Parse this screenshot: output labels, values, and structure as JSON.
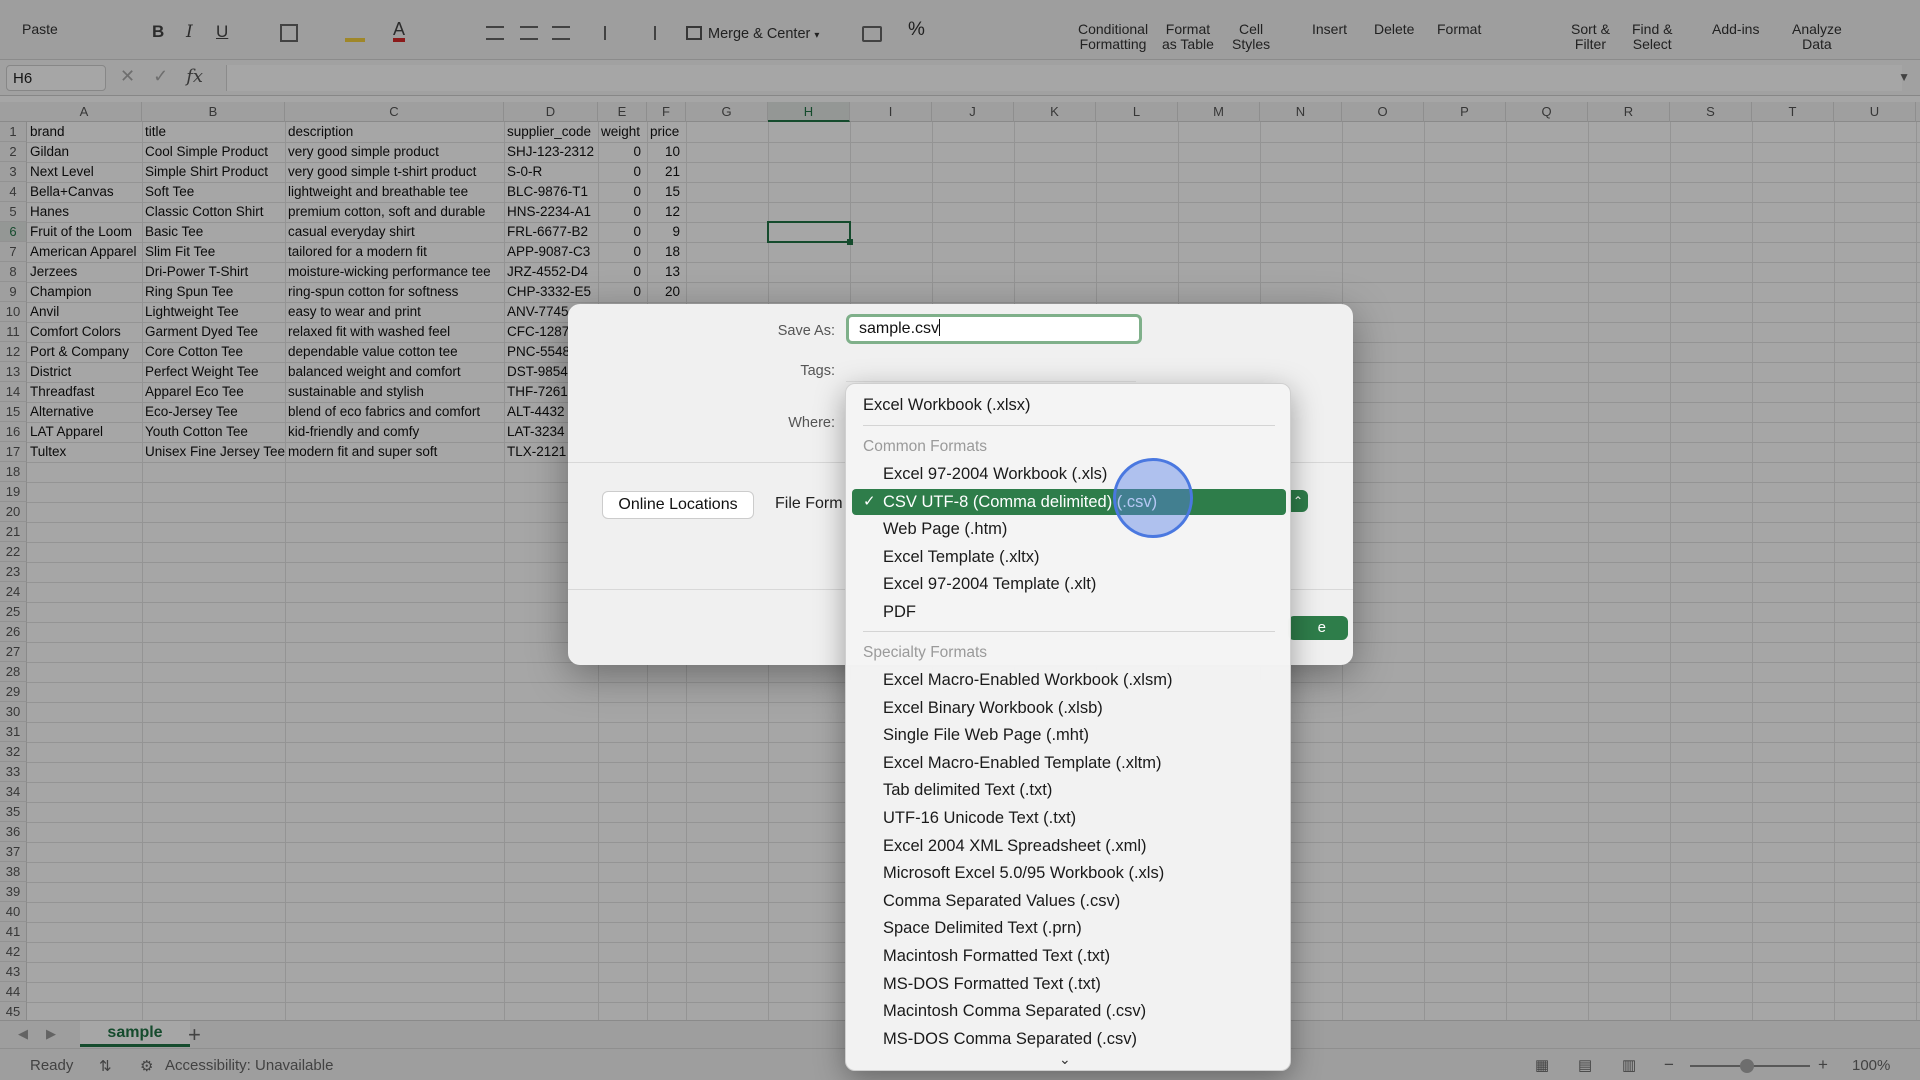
{
  "ribbon": {
    "paste": "Paste",
    "merge_center": "Merge & Center",
    "conditional_formatting": [
      "Conditional",
      "Formatting"
    ],
    "format_as_table": [
      "Format",
      "as Table"
    ],
    "cell_styles": [
      "Cell",
      "Styles"
    ],
    "insert": "Insert",
    "delete": "Delete",
    "format": "Format",
    "sort_filter": [
      "Sort &",
      "Filter"
    ],
    "find_select": [
      "Find &",
      "Select"
    ],
    "add_ins": "Add-ins",
    "analyze_data": [
      "Analyze",
      "Data"
    ],
    "font_buttons": [
      "B",
      "I",
      "U"
    ],
    "percent": "%"
  },
  "formula_bar": {
    "name_box": "H6",
    "fx": "fx"
  },
  "sheet": {
    "columns": [
      "A",
      "B",
      "C",
      "D",
      "E",
      "F",
      "G",
      "H",
      "I",
      "J",
      "K",
      "L",
      "M",
      "N",
      "O",
      "P",
      "Q",
      "R",
      "S",
      "T",
      "U"
    ],
    "selected_column": "H",
    "selected_row": 6,
    "row_count": 45,
    "header": [
      "brand",
      "title",
      "description",
      "supplier_code",
      "weight",
      "price"
    ],
    "rows": [
      [
        "Gildan",
        "Cool Simple Product",
        "very good simple product",
        "SHJ-123-2312",
        "0",
        "10"
      ],
      [
        "Next Level",
        "Simple Shirt Product",
        "very good simple t-shirt product",
        "S-0-R",
        "0",
        "21"
      ],
      [
        "Bella+Canvas",
        "Soft Tee",
        "lightweight and breathable tee",
        "BLC-9876-T1",
        "0",
        "15"
      ],
      [
        "Hanes",
        "Classic Cotton Shirt",
        "premium cotton, soft and durable",
        "HNS-2234-A1",
        "0",
        "12"
      ],
      [
        "Fruit of the Loom",
        "Basic Tee",
        "casual everyday shirt",
        "FRL-6677-B2",
        "0",
        "9"
      ],
      [
        "American Apparel",
        "Slim Fit Tee",
        "tailored for a modern fit",
        "APP-9087-C3",
        "0",
        "18"
      ],
      [
        "Jerzees",
        "Dri-Power T-Shirt",
        "moisture-wicking performance tee",
        "JRZ-4552-D4",
        "0",
        "13"
      ],
      [
        "Champion",
        "Ring Spun Tee",
        "ring-spun cotton for softness",
        "CHP-3332-E5",
        "0",
        "20"
      ],
      [
        "Anvil",
        "Lightweight Tee",
        "easy to wear and print",
        "ANV-7745",
        "",
        ""
      ],
      [
        "Comfort Colors",
        "Garment Dyed Tee",
        "relaxed fit with washed feel",
        "CFC-1287",
        "",
        ""
      ],
      [
        "Port & Company",
        "Core Cotton Tee",
        "dependable value cotton tee",
        "PNC-5548",
        "",
        ""
      ],
      [
        "District",
        "Perfect Weight Tee",
        "balanced weight and comfort",
        "DST-9854",
        "",
        ""
      ],
      [
        "Threadfast",
        "Apparel Eco Tee",
        "sustainable and stylish",
        "THF-7261",
        "",
        ""
      ],
      [
        "Alternative",
        "Eco-Jersey Tee",
        "blend of eco fabrics and comfort",
        "ALT-4432",
        "",
        ""
      ],
      [
        "LAT Apparel",
        "Youth Cotton Tee",
        "kid-friendly and comfy",
        "LAT-3234",
        "",
        ""
      ],
      [
        "Tultex",
        "Unisex Fine Jersey Tee",
        "modern fit and super soft",
        "TLX-2121",
        "",
        ""
      ]
    ],
    "tab_name": "sample"
  },
  "status": {
    "ready": "Ready",
    "accessibility": "Accessibility: Unavailable",
    "zoom": "100%"
  },
  "dialog": {
    "save_as_label": "Save As:",
    "save_as_value": "sample.csv",
    "tags_label": "Tags:",
    "where_label": "Where:",
    "online_locations": "Online Locations",
    "file_format_label": "File Form",
    "save_button": "e"
  },
  "format_menu": {
    "top_item": "Excel Workbook (.xlsx)",
    "common_header": "Common Formats",
    "common": [
      "Excel 97-2004 Workbook (.xls)",
      "CSV UTF-8 (Comma delimited) (.csv)",
      "Web Page (.htm)",
      "Excel Template (.xltx)",
      "Excel 97-2004 Template (.xlt)",
      "PDF"
    ],
    "selected_index": 1,
    "check": "✓",
    "specialty_header": "Specialty Formats",
    "specialty": [
      "Excel Macro-Enabled Workbook (.xlsm)",
      "Excel Binary Workbook (.xlsb)",
      "Single File Web Page (.mht)",
      "Excel Macro-Enabled Template (.xltm)",
      "Tab delimited Text (.txt)",
      "UTF-16 Unicode Text (.txt)",
      "Excel 2004 XML Spreadsheet (.xml)",
      "Microsoft Excel 5.0/95 Workbook (.xls)",
      "Comma Separated Values (.csv)",
      "Space Delimited Text (.prn)",
      "Macintosh Formatted Text (.txt)",
      "MS-DOS Formatted Text (.txt)",
      "Macintosh Comma Separated (.csv)",
      "MS-DOS Comma Separated (.csv)"
    ],
    "scroll_indicator": "⌄"
  },
  "colors": {
    "accent": "#217346",
    "selected": "#2e7d4a"
  }
}
